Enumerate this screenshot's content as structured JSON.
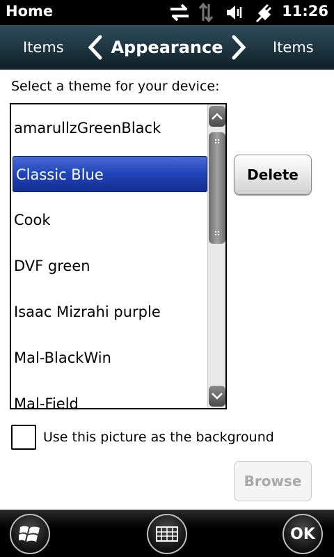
{
  "status_bar": {
    "title": "Home",
    "time": "11:26",
    "icons": [
      "data-sync-icon",
      "network-off-icon",
      "volume-icon",
      "charging-plug-icon"
    ]
  },
  "header": {
    "prev_tab": "Items",
    "current_tab": "Appearance",
    "next_tab": "Items"
  },
  "main": {
    "prompt": "Select a theme for your device:",
    "themes": [
      {
        "label": "amarullzGreenBlack",
        "selected": false
      },
      {
        "label": "Classic Blue",
        "selected": true
      },
      {
        "label": "Cook",
        "selected": false
      },
      {
        "label": "DVF green",
        "selected": false
      },
      {
        "label": "Isaac Mizrahi purple",
        "selected": false
      },
      {
        "label": "Mal-BlackWin",
        "selected": false
      },
      {
        "label": "Mal-Field",
        "selected": false
      }
    ],
    "delete_label": "Delete",
    "background_checkbox": {
      "label": "Use this picture as the background",
      "checked": false
    },
    "browse_label": "Browse"
  },
  "bottom_bar": {
    "ok_label": "OK",
    "start_icon": "windows-start-icon",
    "keyboard_icon": "keyboard-icon"
  },
  "colors": {
    "selection": "#1f43b8",
    "header_bg": "#203a45",
    "disabled_text": "#a8a8a8"
  }
}
